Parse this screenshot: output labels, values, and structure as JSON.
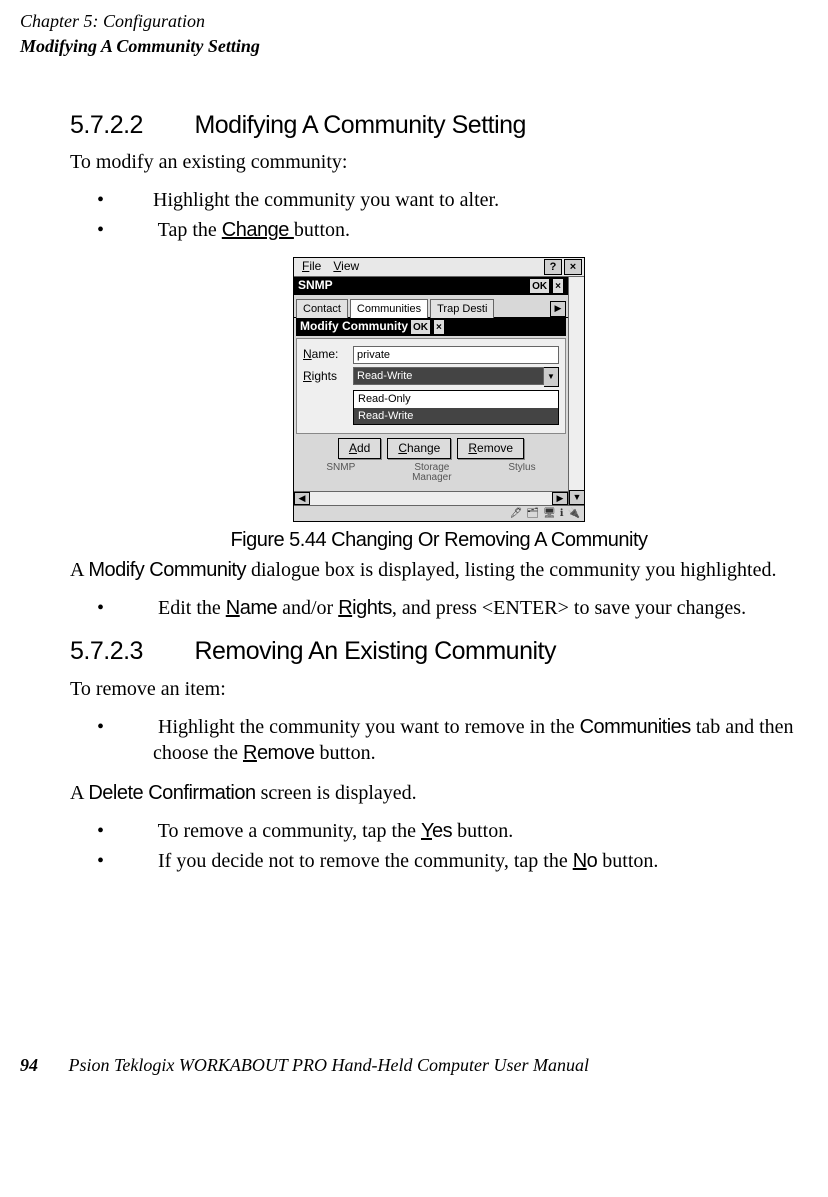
{
  "header": {
    "chapter": "Chapter 5: Configuration",
    "section": "Modifying A Community Setting"
  },
  "s1": {
    "num": "5.7.2.2",
    "title": "Modifying A Community Setting",
    "intro": "To modify an existing community:",
    "b1": "Highlight the community you want to alter.",
    "b2a": "Tap the ",
    "b2b": "Change ",
    "b2c": "button."
  },
  "figure": {
    "caption": "Figure 5.44 Changing Or Removing A Community"
  },
  "device": {
    "menu_file": "File",
    "menu_view": "View",
    "help": "?",
    "close": "×",
    "snmp_title": "SNMP",
    "ok": "OK",
    "tab_contact": "Contact",
    "tab_comm": "Communities",
    "tab_trap": "Trap Desti",
    "mod_title": "Modify Community",
    "lbl_name": "Name:",
    "lbl_rights": "Rights",
    "val_name": "private",
    "val_rights": "Read-Write",
    "opt_ro": "Read-Only",
    "opt_rw": "Read-Write",
    "btn_add": "Add",
    "btn_change": "Change",
    "btn_remove": "Remove",
    "icon_snmp": "SNMP",
    "icon_sm1": "Storage",
    "icon_sm2": "Manager",
    "icon_stylus": "Stylus",
    "arr_l": "◀",
    "arr_r": "▶",
    "arr_d": "▼"
  },
  "after_fig": {
    "p1a": "A ",
    "p1b": "Modify Community",
    "p1c": " dialogue box is displayed, listing the community you highlighted.",
    "b1a": "Edit the ",
    "b1b": "Name",
    "b1c": " and/or ",
    "b1d": "Rights",
    "b1e": ", and press <ENTER> to save your changes."
  },
  "s2": {
    "num": "5.7.2.3",
    "title": "Removing An Existing Community",
    "intro": "To remove an item:",
    "b1a": "Highlight the community you want to remove in the ",
    "b1b": "Communities",
    "b1c": " tab and then choose the ",
    "b1d": "Remove",
    "b1e": " button.",
    "p2a": "A ",
    "p2b": "Delete Confirmation",
    "p2c": " screen is displayed.",
    "b2a": "To remove a community, tap the ",
    "b2b": "Yes",
    "b2c": " button.",
    "b3a": "If you decide not to remove the community, tap the ",
    "b3b": "No",
    "b3c": " button."
  },
  "footer": {
    "page": "94",
    "title": "Psion Teklogix WORKABOUT PRO Hand-Held Computer User Manual"
  }
}
